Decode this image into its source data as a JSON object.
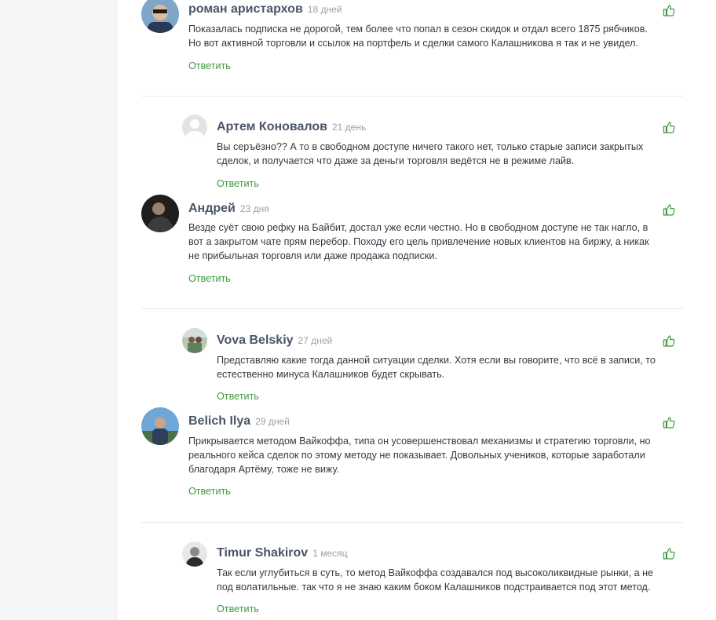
{
  "reply_label": "Ответить",
  "accent_color": "#3d9b3d",
  "comments": [
    {
      "name": "роман аристархов",
      "date": "18 дней",
      "lines": [
        "Показалась подписка не дорогой, тем более что попал в сезон скидок и отдал всего 1875 рябчиков.",
        "Но вот активной торговли и ссылок на портфель и сделки самого Калашникова я так и не увидел."
      ]
    },
    {
      "name": "Артем Коновалов",
      "date": "21 день",
      "lines": [
        "Вы серъёзно?? А то в свободном доступе ничего такого нет, только старые записи закрытых",
        "сделок, и получается что даже за деньги торговля ведётся не в режиме лайв."
      ]
    },
    {
      "name": "Андрей",
      "date": "23 дня",
      "lines": [
        "Везде суёт свою рефку на Байбит, достал уже если честно. Но в свободном доступе не так нагло, в",
        "вот а закрытом чате прям перебор. Походу его цель привлечение новых клиентов на биржу, а никак",
        "не прибыльная торговля или даже продажа подписки."
      ]
    },
    {
      "name": "Vova Belskiy",
      "date": "27 дней",
      "lines": [
        "Представляю какие тогда данной ситуации сделки. Хотя если вы говорите, что всё в записи, то",
        "естественно минуса Калашников будет скрывать."
      ]
    },
    {
      "name": "Belich Ilya",
      "date": "29 дней",
      "lines": [
        "Прикрывается методом Вайкоффа, типа он усовершенствовал механизмы и стратегию торговли, но",
        "реального кейса сделок по этому методу не показывает. Довольных учеников, которые заработали",
        "благодаря Артёму, тоже не вижу."
      ]
    },
    {
      "name": "Timur Shakirov",
      "date": "1 месяц",
      "lines": [
        "Так если углубиться в суть, то метод Вайкоффа создавался под высоколиквидные рынки, а не",
        "под волатильные. так что я не знаю каким боком Калашников подстраивается под этот метод."
      ]
    }
  ]
}
